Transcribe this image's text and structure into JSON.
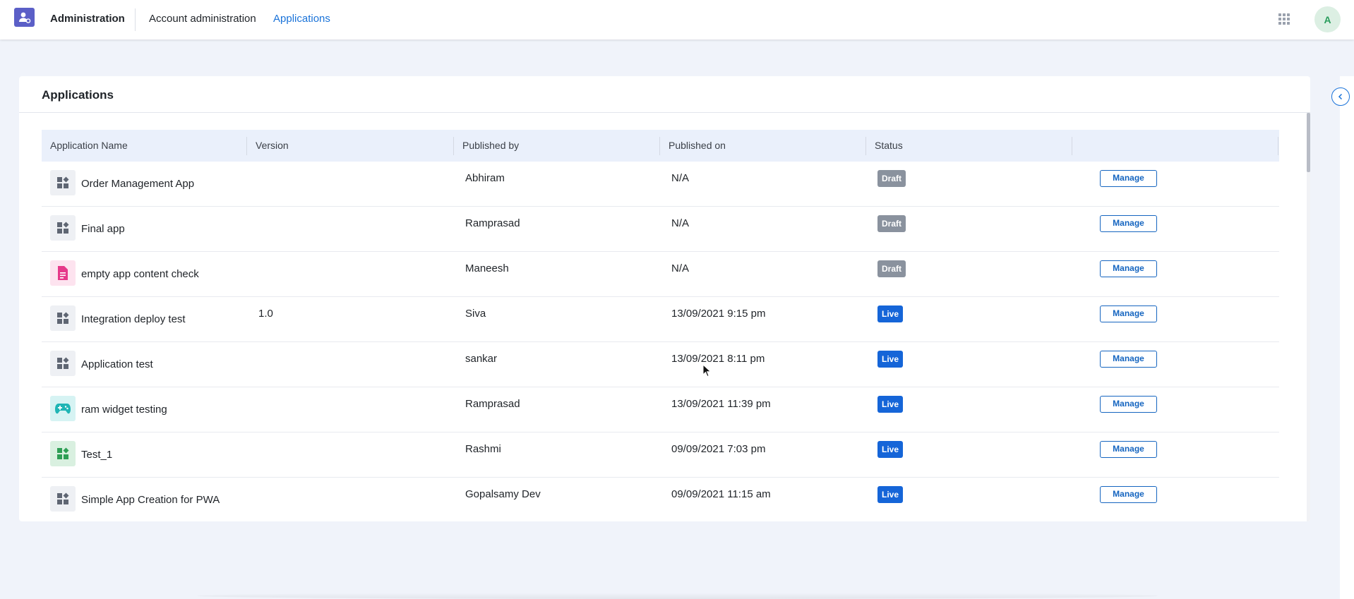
{
  "header": {
    "brand": "Administration",
    "nav": [
      {
        "label": "Account administration"
      },
      {
        "label": "Applications"
      }
    ],
    "avatar_initial": "A",
    "accent_color": "#1a73d9"
  },
  "card": {
    "title": "Applications",
    "columns": [
      "Application Name",
      "Version",
      "Published by",
      "Published on",
      "Status"
    ],
    "rows": [
      {
        "icon": "widget-grid-icon",
        "icon_bg": "#eef0f4",
        "icon_fg": "#5f6673",
        "name": "Order Management App",
        "version": "",
        "published_by": "Abhiram",
        "published_on": "N/A",
        "status": "Draft",
        "action": "Manage"
      },
      {
        "icon": "widget-grid-icon",
        "icon_bg": "#eef0f4",
        "icon_fg": "#5f6673",
        "name": "Final app",
        "version": "",
        "published_by": "Ramprasad",
        "published_on": "N/A",
        "status": "Draft",
        "action": "Manage"
      },
      {
        "icon": "document-icon",
        "icon_bg": "#fde3ef",
        "icon_fg": "#e6398a",
        "name": "empty app content check",
        "version": "",
        "published_by": "Maneesh",
        "published_on": "N/A",
        "status": "Draft",
        "action": "Manage"
      },
      {
        "icon": "widget-grid-icon",
        "icon_bg": "#eef0f4",
        "icon_fg": "#5f6673",
        "name": "Integration deploy test",
        "version": "1.0",
        "published_by": "Siva",
        "published_on": "13/09/2021 9:15 pm",
        "status": "Live",
        "action": "Manage"
      },
      {
        "icon": "widget-grid-icon",
        "icon_bg": "#eef0f4",
        "icon_fg": "#5f6673",
        "name": "Application test",
        "version": "",
        "published_by": "sankar",
        "published_on": "13/09/2021 8:11 pm",
        "status": "Live",
        "action": "Manage"
      },
      {
        "icon": "gamepad-icon",
        "icon_bg": "#d6f3f3",
        "icon_fg": "#1fb5b5",
        "name": "ram widget testing",
        "version": "",
        "published_by": "Ramprasad",
        "published_on": "13/09/2021 11:39 pm",
        "status": "Live",
        "action": "Manage"
      },
      {
        "icon": "widget-grid-icon",
        "icon_bg": "#d9f0e0",
        "icon_fg": "#2e9e55",
        "name": "Test_1",
        "version": "",
        "published_by": "Rashmi",
        "published_on": "09/09/2021 7:03 pm",
        "status": "Live",
        "action": "Manage"
      },
      {
        "icon": "widget-grid-icon",
        "icon_bg": "#eef0f4",
        "icon_fg": "#5f6673",
        "name": "Simple App Creation for PWA",
        "version": "",
        "published_by": "Gopalsamy Dev",
        "published_on": "09/09/2021 11:15 am",
        "status": "Live",
        "action": "Manage"
      }
    ],
    "status_colors": {
      "Draft": "#8a929e",
      "Live": "#1565d8"
    }
  }
}
